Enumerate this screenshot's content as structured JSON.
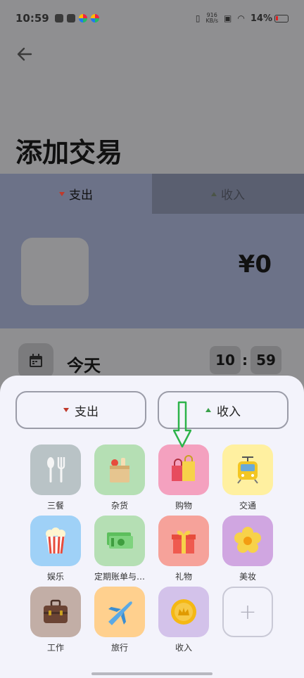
{
  "status_bar": {
    "time": "10:59",
    "net_speed_value": "916",
    "net_speed_unit": "KB/s",
    "battery": "14%"
  },
  "page": {
    "title": "添加交易",
    "tabs": [
      {
        "label": "支出"
      },
      {
        "label": "收入"
      }
    ],
    "amount": "¥0",
    "date": "今天",
    "time_hour": "10",
    "time_separator": ":",
    "time_minute": "59"
  },
  "sheet": {
    "tabs": [
      {
        "label": "支出"
      },
      {
        "label": "收入"
      }
    ],
    "categories": [
      {
        "label": "三餐",
        "icon": "utensils-icon",
        "color": "#b9c3c6"
      },
      {
        "label": "杂货",
        "icon": "grocery-bag-icon",
        "color": "#b5dfb4"
      },
      {
        "label": "购物",
        "icon": "shopping-bags-icon",
        "color": "#f4a1bf"
      },
      {
        "label": "交通",
        "icon": "tram-icon",
        "color": "#fff0a0"
      },
      {
        "label": "娱乐",
        "icon": "popcorn-icon",
        "color": "#9fd1f7"
      },
      {
        "label": "定期账单与…",
        "icon": "money-stack-icon",
        "color": "#b5dfb4"
      },
      {
        "label": "礼物",
        "icon": "gift-icon",
        "color": "#f6a29a"
      },
      {
        "label": "美妆",
        "icon": "flower-icon",
        "color": "#d0a6e1"
      },
      {
        "label": "工作",
        "icon": "briefcase-icon",
        "color": "#c2aea6"
      },
      {
        "label": "旅行",
        "icon": "airplane-icon",
        "color": "#ffd08e"
      },
      {
        "label": "收入",
        "icon": "coin-icon",
        "color": "#d3c2ea"
      }
    ],
    "add_label": "+"
  },
  "colors": {
    "expense_marker": "#c0392b",
    "income_marker": "#3aa04a",
    "hint_arrow": "#2db34a"
  }
}
